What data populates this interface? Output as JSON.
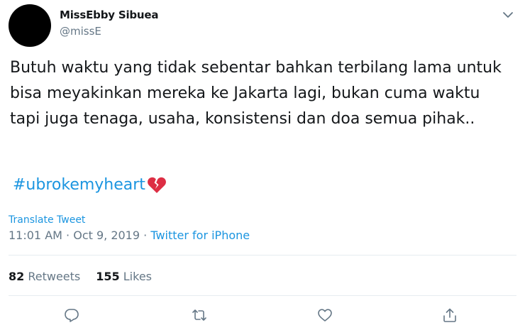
{
  "user": {
    "display_name": "MissEbby Sibuea",
    "handle": "@missE"
  },
  "tweet": {
    "text": "Butuh waktu yang tidak sebentar bahkan terbilang lama untuk bisa meyakinkan mereka ke Jakarta lagi, bukan cuma waktu tapi juga tenaga, usaha, konsistensi dan doa semua pihak..",
    "hashtag": "#ubrokemyheart",
    "emoji_icon": "broken-heart-icon",
    "translate_label": "Translate Tweet",
    "time": "11:01 AM",
    "separator": " · ",
    "date": "Oct 9, 2019",
    "source": "Twitter for iPhone"
  },
  "stats": {
    "retweets_count": "82",
    "retweets_label": "Retweets",
    "likes_count": "155",
    "likes_label": "Likes"
  },
  "actions": [
    {
      "icon": "reply-icon"
    },
    {
      "icon": "retweet-icon"
    },
    {
      "icon": "like-icon"
    },
    {
      "icon": "share-icon"
    }
  ],
  "colors": {
    "link": "#1b95e0",
    "muted": "#657786",
    "text": "#14171a",
    "divider": "#e6ecf0",
    "emoji_red": "#dd2e44"
  }
}
